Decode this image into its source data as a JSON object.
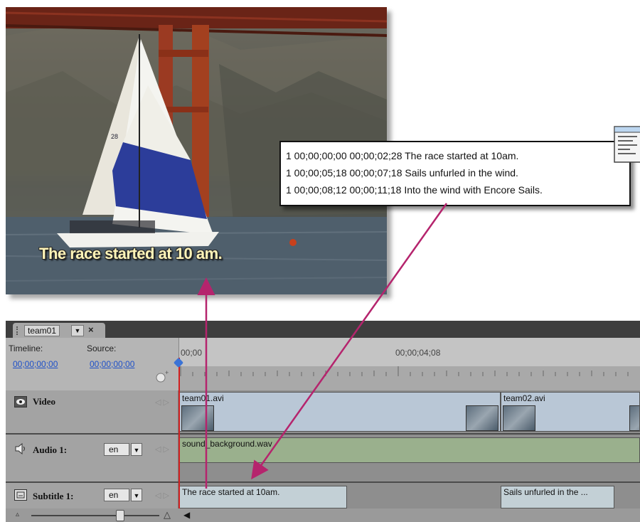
{
  "colors": {
    "arrow": "#b5246d",
    "accent_link": "#1e50c8",
    "playhead": "#d21f1f"
  },
  "video_preview": {
    "caption": "The race started at 10 am."
  },
  "subtitle_script": {
    "lines": [
      "1 00;00;00;00 00;00;02;28 The race started at 10am.",
      "1 00;00;05;18 00;00;07;18 Sails unfurled in the wind.",
      "1 00;00;08;12 00;00;11;18 Into the wind with Encore Sails."
    ],
    "icon": "notepad-text-file-icon"
  },
  "timeline": {
    "tab": {
      "name": "team01",
      "dropdown_icon": "chevron-down-icon",
      "close": "×"
    },
    "timeline_label": "Timeline:",
    "timeline_tc": "00;00;00;00",
    "source_label": "Source:",
    "source_tc": "00;00;00;00",
    "ruler": {
      "start": "00;00",
      "mark": "00;00;04;08"
    },
    "tracks": {
      "video": {
        "name": "Video",
        "clips": [
          "team01.avi",
          "team02.avi"
        ]
      },
      "audio": {
        "name": "Audio 1:",
        "lang": "en",
        "clip": "sound_background.wav"
      },
      "subtitle": {
        "name": "Subtitle 1:",
        "lang": "en",
        "clips": [
          "The race started at 10am.",
          "Sails unfurled in the ..."
        ]
      }
    }
  }
}
